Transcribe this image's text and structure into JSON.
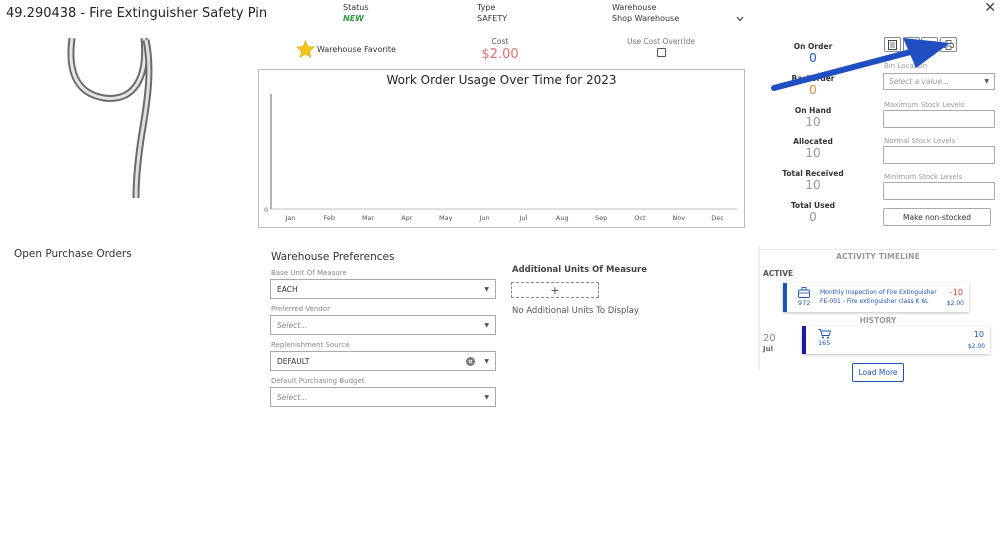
{
  "header": {
    "title": "49.290438 - Fire Extinguisher Safety Pin",
    "status_label": "Status",
    "status_value": "NEW",
    "type_label": "Type",
    "type_value": "SAFETY",
    "warehouse_label": "Warehouse",
    "warehouse_value": "Shop Warehouse"
  },
  "favorite_label": "Warehouse Favorite",
  "cost": {
    "label": "Cost",
    "value": "$2.00"
  },
  "override_label": "Use Cost Override",
  "chart_data": {
    "type": "line",
    "title": "Work Order Usage Over Time for 2023",
    "categories": [
      "Jan",
      "Feb",
      "Mar",
      "Apr",
      "May",
      "Jun",
      "Jul",
      "Aug",
      "Sep",
      "Oct",
      "Nov",
      "Dec"
    ],
    "values": [
      0,
      0,
      0,
      0,
      0,
      0,
      0,
      0,
      0,
      0,
      0,
      0
    ],
    "ytick": "0",
    "xlabel": "",
    "ylabel": ""
  },
  "stats": [
    {
      "label": "On Order",
      "value": "0",
      "color": "#1a55b5"
    },
    {
      "label": "Backorder",
      "value": "0",
      "color": "#e08a3a"
    },
    {
      "label": "On Hand",
      "value": "10",
      "color": "#999999"
    },
    {
      "label": "Allocated",
      "value": "10",
      "color": "#999999"
    },
    {
      "label": "Total Received",
      "value": "10",
      "color": "#999999"
    },
    {
      "label": "Total Used",
      "value": "0",
      "color": "#999999"
    }
  ],
  "right_fields": {
    "bin_location_label": "Bin Location",
    "bin_location_placeholder": "Select a value...",
    "max_label": "Maximum Stock Levels",
    "normal_label": "Normal Stock Levels",
    "min_label": "Minimum Stock Levels",
    "non_stocked_button": "Make non-stocked"
  },
  "open_po_title": "Open Purchase Orders",
  "warehouse_prefs": {
    "title": "Warehouse Preferences",
    "base_uom_label": "Base Unit Of Measure",
    "base_uom_value": "EACH",
    "vendor_label": "Preferred Vendor",
    "vendor_placeholder": "Select...",
    "replenishment_label": "Replenishment Source",
    "replenishment_value": "DEFAULT",
    "budget_label": "Default Purchasing Budget",
    "budget_placeholder": "Select..."
  },
  "additional_units": {
    "title": "Additional Units Of Measure",
    "add_symbol": "+",
    "empty_text": "No Additional Units To Display"
  },
  "timeline": {
    "title": "ACTIVITY TIMELINE",
    "active_label": "ACTIVE",
    "active_card": {
      "id": "972",
      "title": "Monthly Inspection of Fire Extinguisher",
      "subtitle": "FE-001 - Fire extinguisher class K 6L",
      "qty": "-10",
      "price": "$2.00"
    },
    "history_label": "HISTORY",
    "history_day": "20",
    "history_month": "Jul",
    "history_card": {
      "id": "165",
      "qty": "10",
      "price": "$2.00"
    },
    "load_more": "Load More"
  },
  "colors": {
    "accent": "#1a55b5",
    "arrow": "#1f4fc0",
    "cost": "#e07070"
  }
}
